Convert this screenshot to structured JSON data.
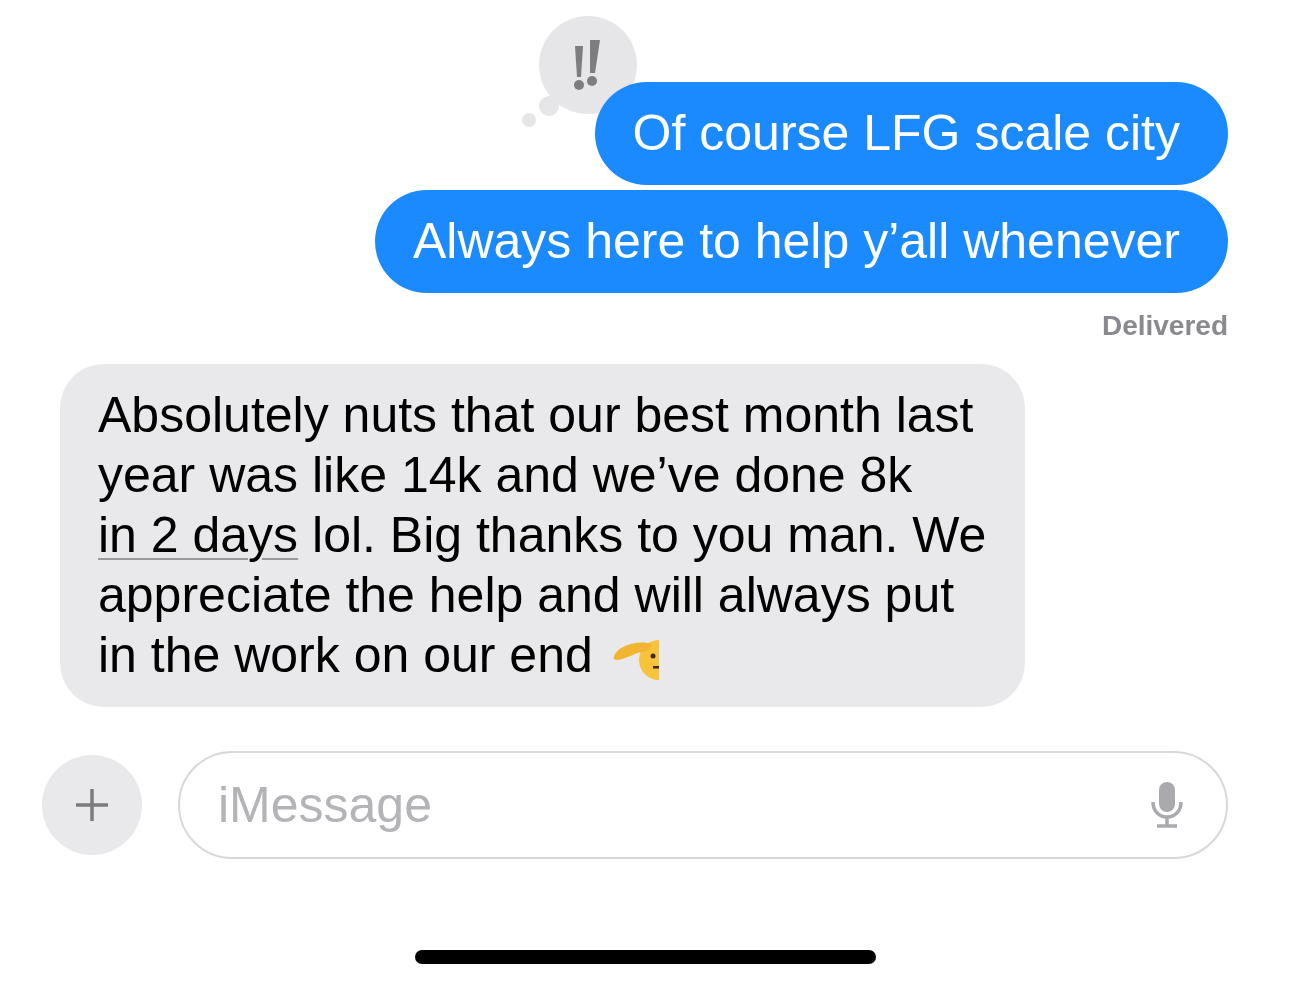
{
  "messages": [
    {
      "kind": "sent",
      "text": "Of course LFG scale city",
      "tapback": {
        "kind": "emphasis"
      }
    },
    {
      "kind": "sent",
      "text": "Always here to help y’all whenever"
    },
    {
      "kind": "status",
      "text": "Delivered"
    },
    {
      "kind": "received",
      "parts": [
        {
          "kind": "plain",
          "text": "Absolutely nuts that our best month last year was like 14k and we’ve done 8k "
        },
        {
          "kind": "link",
          "text": "in 2 days"
        },
        {
          "kind": "plain",
          "text": " lol. Big thanks to you man. We appreciate the help and will always put in the work on our end"
        },
        {
          "kind": "emoji"
        }
      ]
    }
  ],
  "composer": {
    "placeholder": "iMessage"
  }
}
